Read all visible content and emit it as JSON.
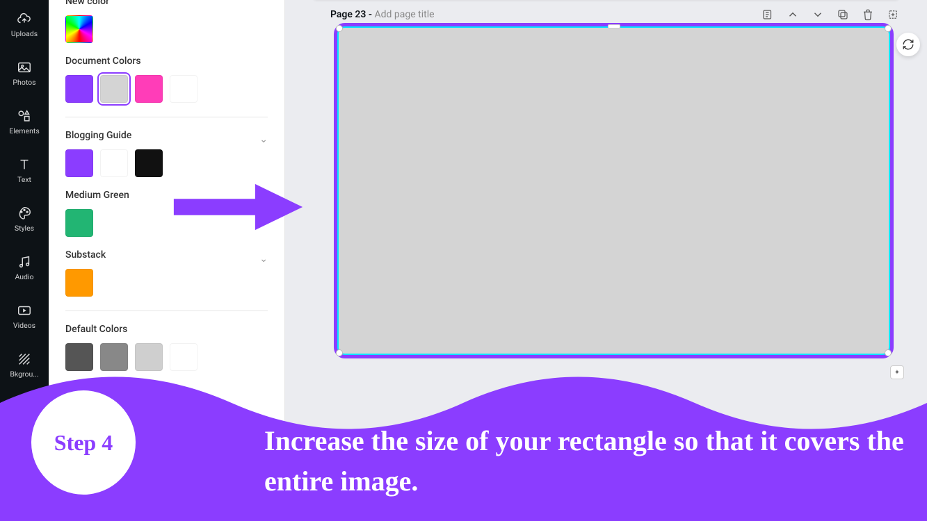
{
  "toolbar": {
    "uploads": "Uploads",
    "photos": "Photos",
    "elements": "Elements",
    "text": "Text",
    "styles": "Styles",
    "audio": "Audio",
    "videos": "Videos",
    "background": "Bkgrou..."
  },
  "panel": {
    "new_color_title": "New color",
    "document_colors_title": "Document Colors",
    "document_colors": [
      {
        "color": "#8b3dff",
        "selected": false
      },
      {
        "color": "#d4d4d4",
        "selected": true
      },
      {
        "color": "#ff3db8",
        "selected": false
      },
      {
        "color": "#ffffff",
        "selected": false
      }
    ],
    "blogging_guide_title": "Blogging Guide",
    "blogging_guide": [
      {
        "color": "#8b3dff"
      },
      {
        "color": "#ffffff"
      },
      {
        "color": "#111111"
      }
    ],
    "medium_green_title": "Medium Green",
    "medium_green": [
      {
        "color": "#22b573"
      }
    ],
    "substack_title": "Substack",
    "substack": [
      {
        "color": "#ff9900"
      }
    ],
    "default_colors_title": "Default Colors",
    "default_colors": [
      {
        "color": "#555555"
      },
      {
        "color": "#888888"
      },
      {
        "color": "#cfcfcf"
      },
      {
        "color": "#ffffff"
      }
    ]
  },
  "canvas": {
    "page_label": "Page 23",
    "page_sep": " - ",
    "page_subtitle": "Add page title"
  },
  "tutorial": {
    "step_label": "Step 4",
    "instruction": "Increase the size of your rectangle so that it covers the entire image."
  }
}
